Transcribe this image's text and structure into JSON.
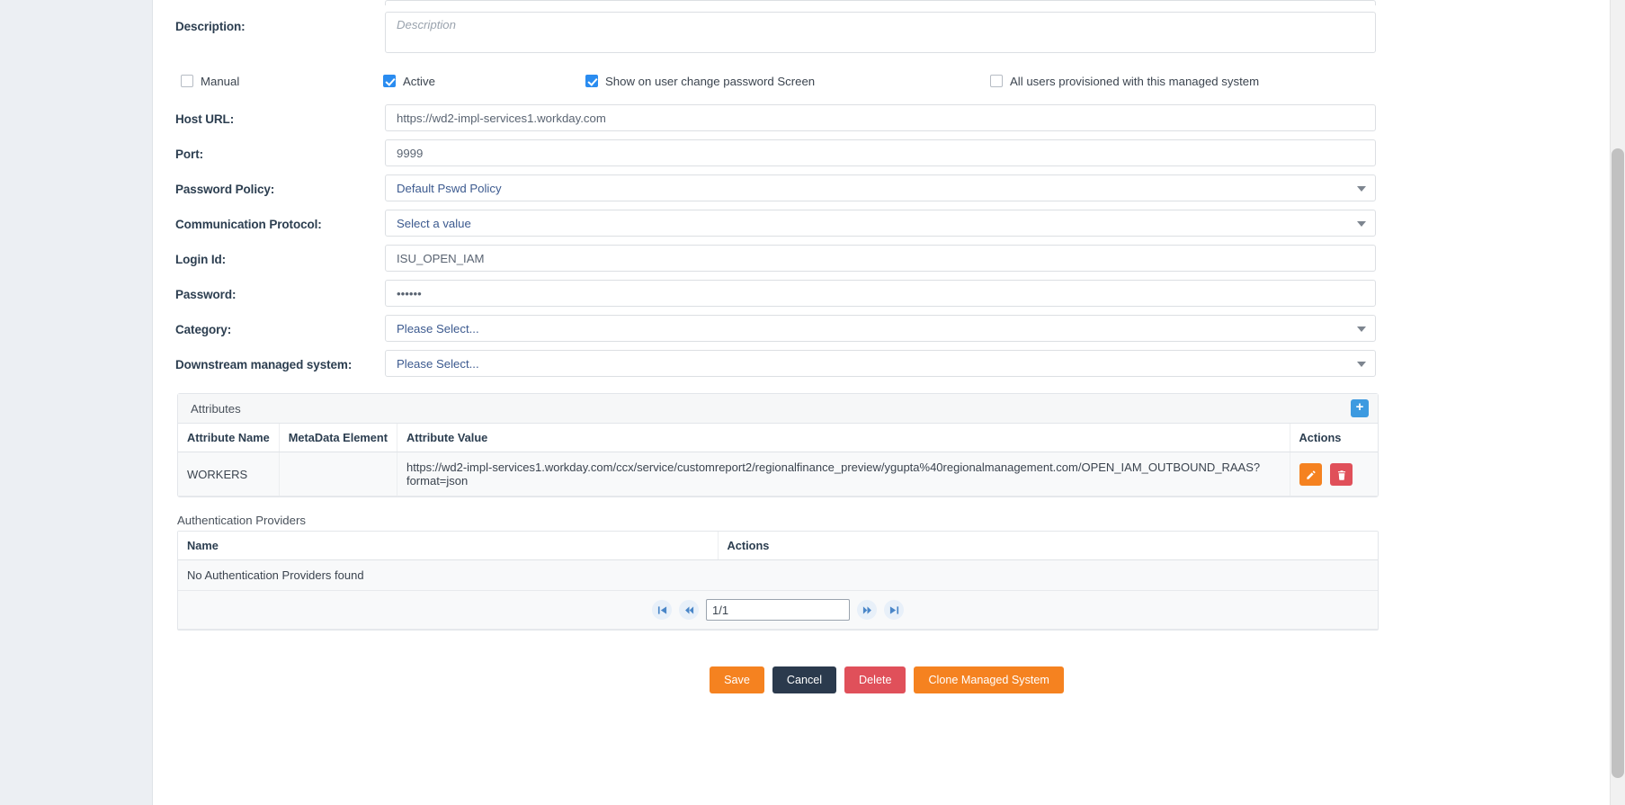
{
  "form": {
    "description": {
      "label": "Description:",
      "placeholder": "Description",
      "value": ""
    },
    "checkboxes": [
      {
        "label": "Manual",
        "checked": false
      },
      {
        "label": "Active",
        "checked": true
      },
      {
        "label": "Show on user change password Screen",
        "checked": true
      },
      {
        "label": "All users provisioned with this managed system",
        "checked": false
      }
    ],
    "host_url": {
      "label": "Host URL:",
      "value": "https://wd2-impl-services1.workday.com"
    },
    "port": {
      "label": "Port:",
      "value": "9999"
    },
    "password_policy": {
      "label": "Password Policy:",
      "value": "Default Pswd Policy"
    },
    "communication_protocol": {
      "label": "Communication Protocol:",
      "value": "Select a value"
    },
    "login_id": {
      "label": "Login Id:",
      "value": "ISU_OPEN_IAM"
    },
    "password": {
      "label": "Password:",
      "value": "••••••"
    },
    "category": {
      "label": "Category:",
      "value": "Please Select..."
    },
    "downstream": {
      "label": "Downstream managed system:",
      "value": "Please Select..."
    }
  },
  "attributes_panel": {
    "title": "Attributes",
    "add_label": "+",
    "columns": [
      "Attribute Name",
      "MetaData Element",
      "Attribute Value",
      "Actions"
    ],
    "rows": [
      {
        "attribute_name": "WORKERS",
        "metadata_element": "",
        "attribute_value": "https://wd2-impl-services1.workday.com/ccx/service/customreport2/regionalfinance_preview/ygupta%40regionalmanagement.com/OPEN_IAM_OUTBOUND_RAAS?format=json"
      }
    ]
  },
  "auth_providers": {
    "label": "Authentication Providers",
    "columns": [
      "Name",
      "Actions"
    ],
    "empty_message": "No Authentication Providers found",
    "pager": {
      "value": "1/1"
    }
  },
  "actions": {
    "save": "Save",
    "cancel": "Cancel",
    "delete": "Delete",
    "clone": "Clone Managed System"
  },
  "colors": {
    "accent_orange": "#f58220",
    "accent_blue": "#3d9ae0",
    "danger_red": "#e0505a",
    "dark_navy": "#2b3a4d",
    "checkbox_blue": "#2a8cf0"
  }
}
